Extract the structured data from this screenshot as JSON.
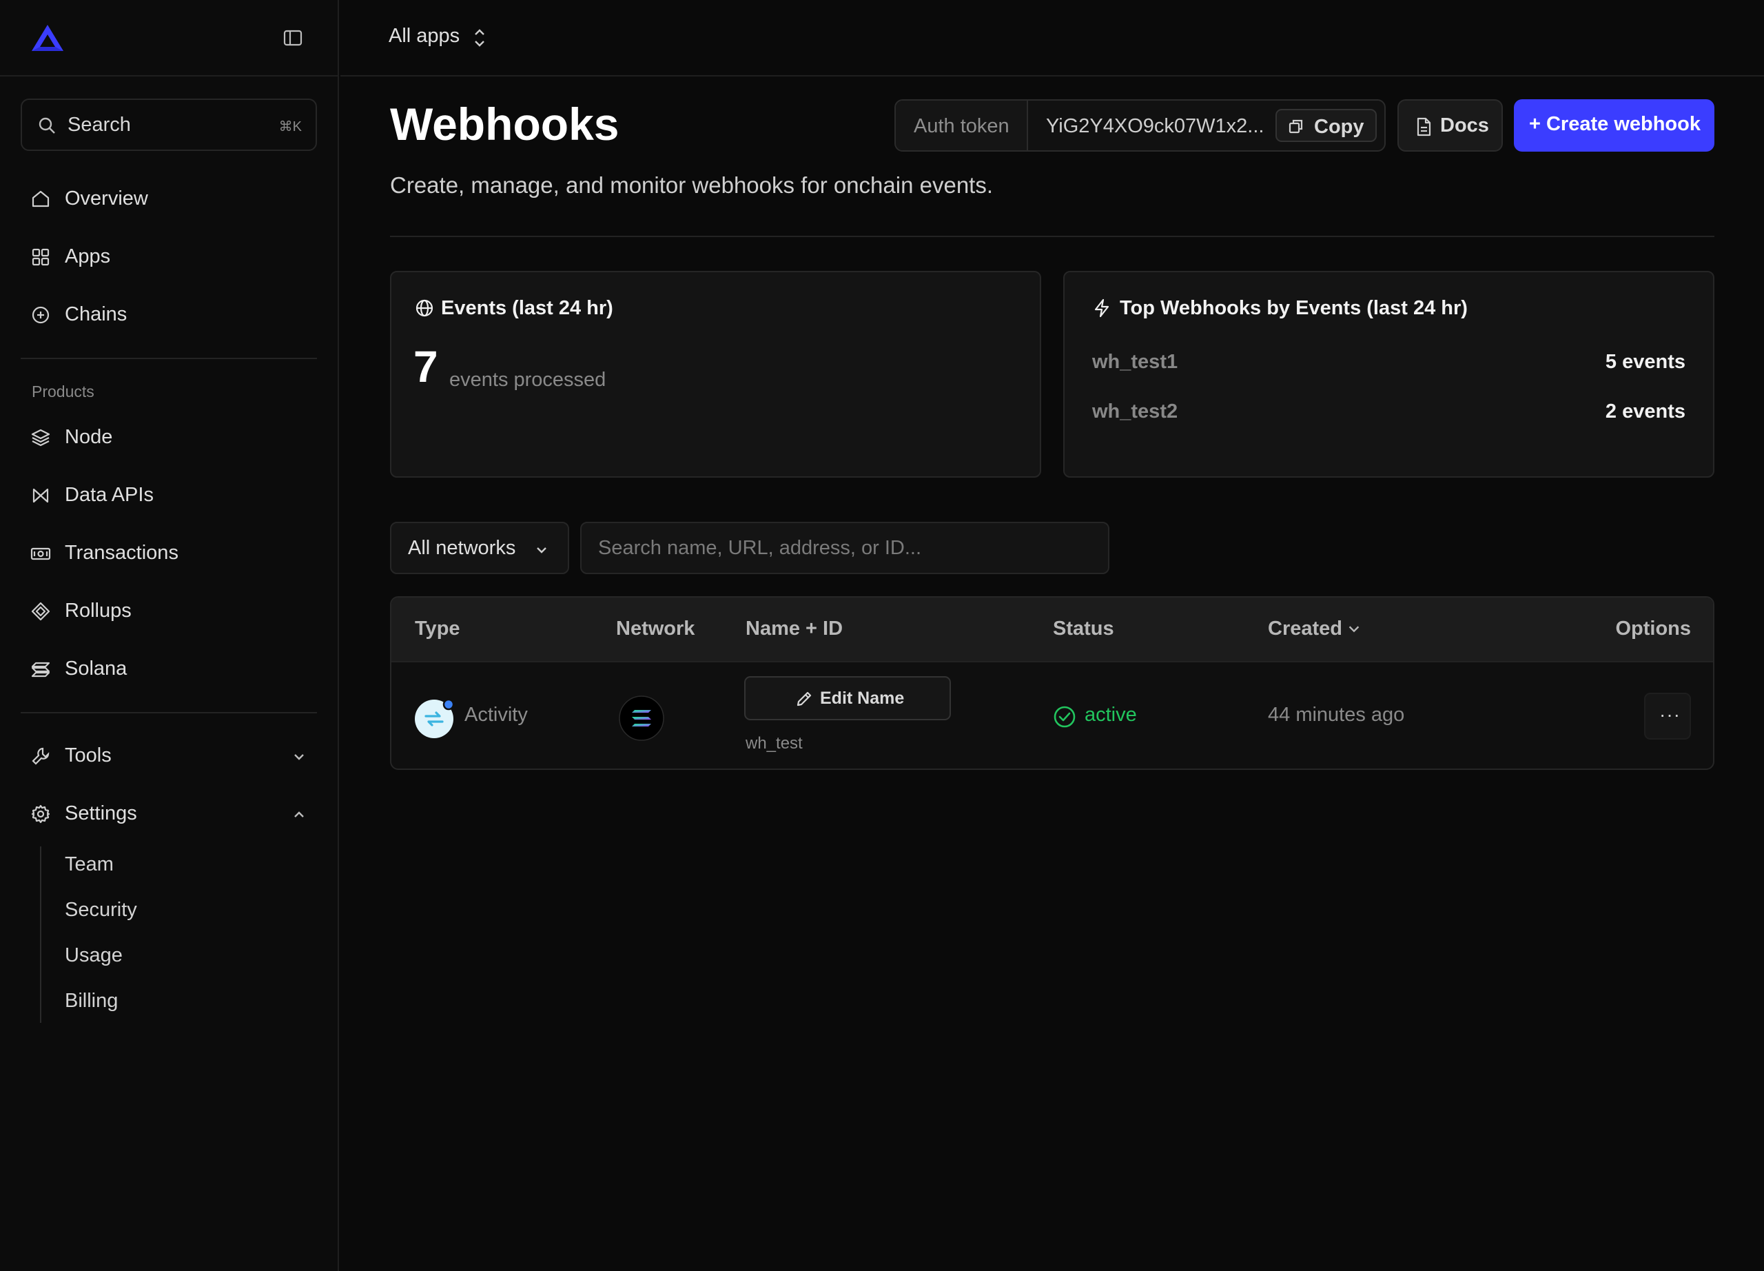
{
  "topbar": {
    "app_switcher": "All apps"
  },
  "sidebar": {
    "search": {
      "label": "Search",
      "shortcut": "⌘K"
    },
    "primary": [
      {
        "label": "Overview",
        "icon": "home-icon"
      },
      {
        "label": "Apps",
        "icon": "grid-icon"
      },
      {
        "label": "Chains",
        "icon": "plus-circle-icon"
      }
    ],
    "products_label": "Products",
    "products": [
      {
        "label": "Node",
        "icon": "layers-icon"
      },
      {
        "label": "Data APIs",
        "icon": "data-api-icon"
      },
      {
        "label": "Transactions",
        "icon": "banknote-icon"
      },
      {
        "label": "Rollups",
        "icon": "stack-icon"
      },
      {
        "label": "Solana",
        "icon": "solana-icon"
      }
    ],
    "tools": {
      "label": "Tools",
      "expanded": false
    },
    "settings": {
      "label": "Settings",
      "expanded": true,
      "children": [
        "Team",
        "Security",
        "Usage",
        "Billing"
      ]
    }
  },
  "header": {
    "title": "Webhooks",
    "subtitle": "Create, manage, and monitor webhooks for onchain events.",
    "auth_token_label": "Auth token",
    "auth_token_value": "YiG2Y4XO9ck07W1x2...",
    "copy_label": "Copy",
    "docs_label": "Docs",
    "create_label": "+ Create webhook"
  },
  "events_card": {
    "title": "Events (last 24 hr)",
    "count": "7",
    "count_label": "events processed"
  },
  "top_card": {
    "title": "Top Webhooks by Events (last 24 hr)",
    "rows": [
      {
        "name": "wh_test1",
        "count": "5 events"
      },
      {
        "name": "wh_test2",
        "count": "2 events"
      }
    ]
  },
  "filters": {
    "network": "All networks",
    "search_placeholder": "Search name, URL, address, or ID..."
  },
  "table": {
    "columns": [
      "Type",
      "Network",
      "Name + ID",
      "Status",
      "Created",
      "Options"
    ],
    "rows": [
      {
        "type": "Activity",
        "network_icon": "solana-icon",
        "edit_label": "Edit Name",
        "id": "wh_test",
        "status": "active",
        "created": "44 minutes ago",
        "options": "···"
      }
    ]
  },
  "colors": {
    "accent": "#3b3dff",
    "status_active": "#22c55e",
    "background": "#0a0a0a"
  }
}
